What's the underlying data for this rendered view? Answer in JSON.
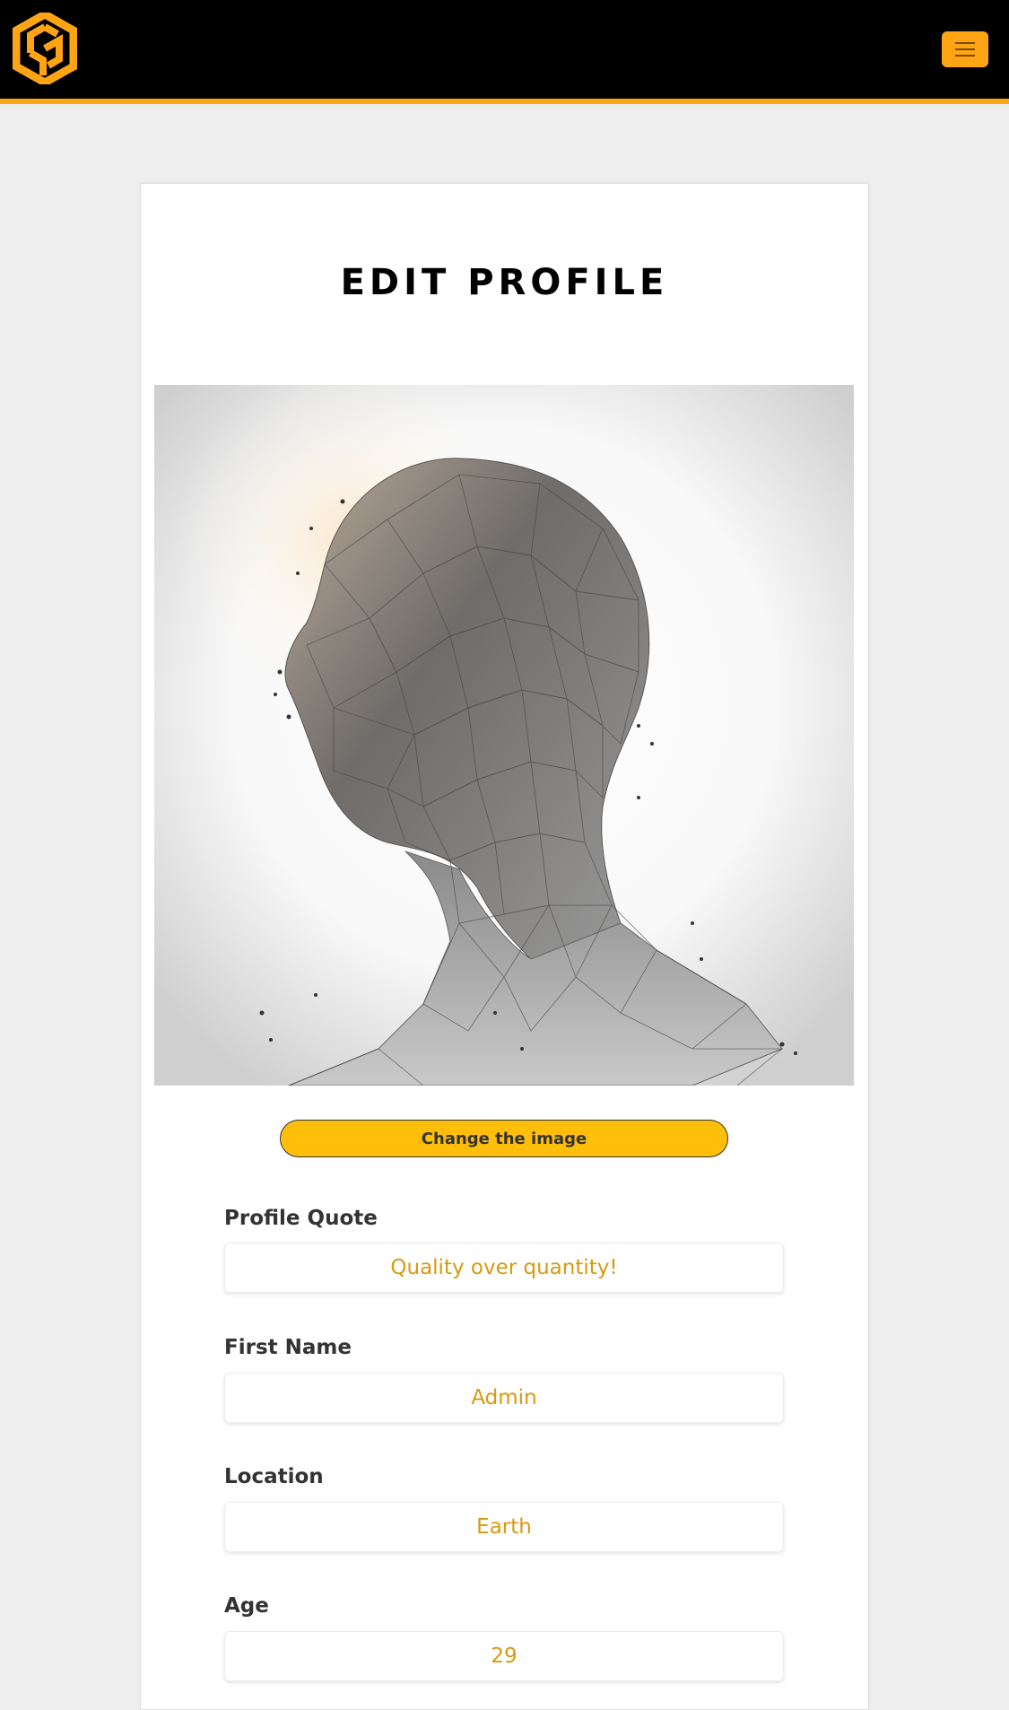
{
  "header": {
    "logo_icon": "cube-logo-icon",
    "menu_icon": "hamburger-menu-icon"
  },
  "page": {
    "title": "EDIT PROFILE"
  },
  "profile_image": {
    "icon": "low-poly-head-profile-image"
  },
  "change_image_button": {
    "label": "Change the image"
  },
  "fields": {
    "profile_quote": {
      "label": "Profile Quote",
      "value": "Quality over quantity!"
    },
    "first_name": {
      "label": "First Name",
      "value": "Admin"
    },
    "location": {
      "label": "Location",
      "value": "Earth"
    },
    "age": {
      "label": "Age",
      "value": "29"
    }
  },
  "colors": {
    "accent": "#ffa514",
    "button": "#ffbe0a",
    "input_text": "#d79a10",
    "background": "#efeeef"
  }
}
